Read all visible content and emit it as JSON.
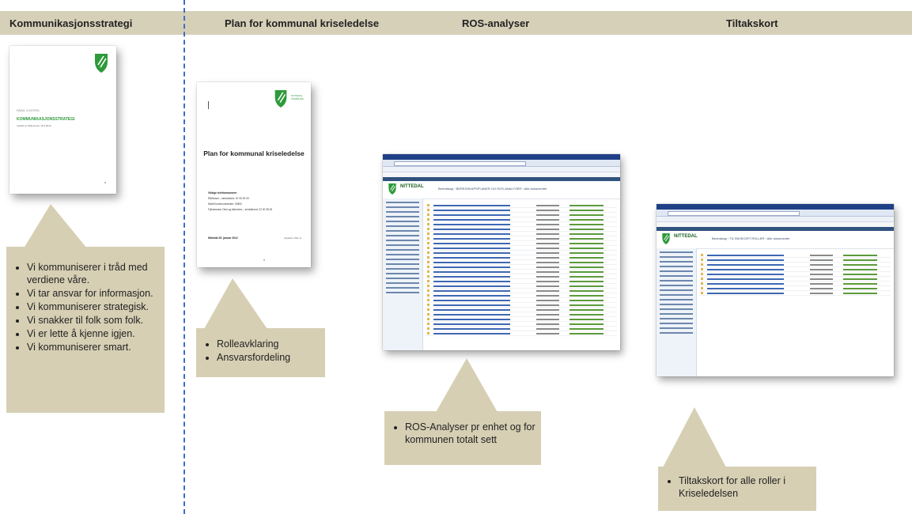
{
  "headers": {
    "col1": "Kommunikasjonsstrategi",
    "col2": "Plan for kommunal  kriseledelse",
    "col3": "ROS-analyser",
    "col4": "Tiltakskort"
  },
  "doc1": {
    "small_text": "RÅDM. & INTERN",
    "title": "KOMMUNIKASJONSSTRATEGI",
    "subtitle": "Vedtatt av rådmannen 19.3.2012"
  },
  "doc2": {
    "logo_text": "NITTEDAL KOMMUNE",
    "title": "Plan for kommunal kriseledelse",
    "phone_heading": "Viktige telefonnummer",
    "phone_1": "Rådhuset – sentralbord: 67 05 00 00",
    "phone_2": "Mobilt kommunesenter: 02800",
    "phone_3": "Fylkesmann Oslo og Akershus – sentralbord: 22 00 35 00",
    "place_date": "Nittedal 25. januar 2012",
    "footer_right": "Oppdatert: 2011-11"
  },
  "callouts": {
    "c1": [
      "Vi kommuniserer  i tråd med verdiene våre.",
      "Vi tar ansvar for informasjon.",
      "Vi kommuniserer strategisk.",
      "Vi snakker til folk som folk.",
      "Vi er lette å kjenne igjen.",
      "Vi kommuniserer smart."
    ],
    "c2": [
      "Rolleavklaring",
      "Ansvarsfordeling"
    ],
    "c3": [
      "ROS-Analyser pr enhet og for kommunen  totalt sett"
    ],
    "c4": [
      "Tiltakskort for alle roller i Kriseledelsen"
    ]
  },
  "screens": {
    "ros": {
      "brand": "NITTEDAL",
      "crumb": "Beredskap › BEREDSKAPSPLANER OG ROS-ANALYSER › Alle dokumenter"
    },
    "tiltak": {
      "brand": "NITTEDAL",
      "crumb": "Beredskap › TILTAKSKORT ROLLER › Alle dokumenter"
    }
  },
  "colors": {
    "header_band": "#d6d0b8",
    "callout": "#d6cfb4",
    "divider": "#3a6fc4",
    "brand_green": "#2e9a3a"
  }
}
